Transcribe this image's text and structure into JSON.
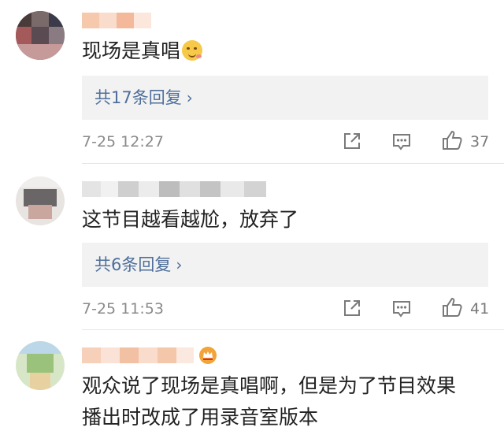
{
  "comments": [
    {
      "text": "现场是真唱",
      "emoji_icon": "drooling-face-icon",
      "reply_label": "共17条回复",
      "timestamp": "7-25 12:27",
      "likes": "37"
    },
    {
      "text": "这节目越看越尬，放弃了",
      "reply_label": "共6条回复",
      "timestamp": "7-25 11:53",
      "likes": "41"
    },
    {
      "text_line1": "观众说了现场是真唱啊，但是为了节目效果",
      "text_line2": "播出时改成了用录音室版本"
    }
  ],
  "colors": {
    "reply_link": "#4e6f9b",
    "reply_bg": "#f2f2f2",
    "meta": "#8a8a8a"
  }
}
